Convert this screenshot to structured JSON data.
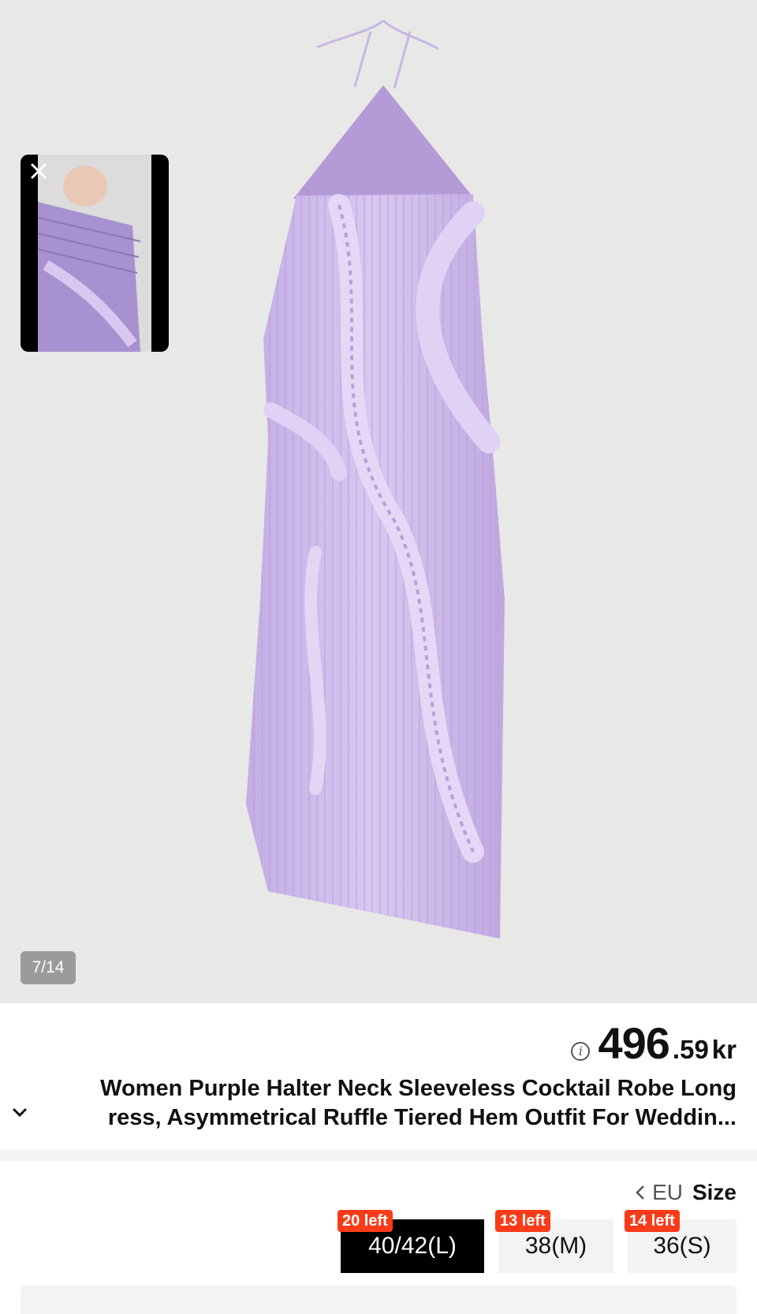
{
  "gallery": {
    "counter": "7/14",
    "image_desc": "lavender pleated halter dress"
  },
  "pip": {
    "close_icon": "close-icon"
  },
  "product": {
    "price_integer": "496",
    "price_decimal": ".59",
    "price_currency": "kr",
    "title_line1": "Women Purple Halter Neck Sleeveless Cocktail Robe Long",
    "title_line2": "ress, Asymmetrical Ruffle Tiered Hem Outfit For Weddin..."
  },
  "size": {
    "label": "Size",
    "region": "EU",
    "options": [
      {
        "label": "40/42(L)",
        "stock": "20 left",
        "selected": true
      },
      {
        "label": "38(M)",
        "stock": "13 left",
        "selected": false
      },
      {
        "label": "36(S)",
        "stock": "14 left",
        "selected": false
      }
    ]
  },
  "colors": {
    "accent_badge": "#fa3b1a",
    "selected_bg": "#000000",
    "dress": "#c9b4e8"
  }
}
